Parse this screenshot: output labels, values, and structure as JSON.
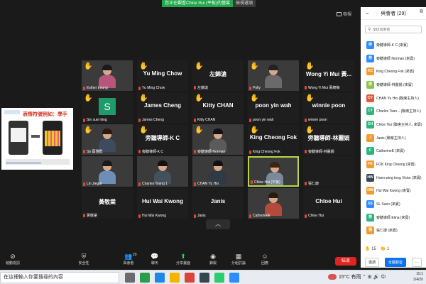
{
  "banner": {
    "sharing": "您正在觀看Chloe Hui (平板)的螢幕",
    "options": "檢視選項"
  },
  "view_label": "檢視",
  "shared_screen": {
    "title": "表情符號例如：學手"
  },
  "tiles": [
    {
      "name": "",
      "label": "Esther Leung",
      "video": true,
      "hand": true,
      "person": {
        "body": "#b5567a",
        "hair": "#1a1a1a"
      }
    },
    {
      "name": "Yu Ming Chow",
      "label": "Yu Ming Chow",
      "video": false,
      "hand": true
    },
    {
      "name": "左錦滄",
      "label": "左錦滄",
      "video": false,
      "hand": true
    },
    {
      "name": "",
      "label": "Polly",
      "video": true,
      "hand": true,
      "person": {
        "body": "#6a6a6a",
        "hair": "#222"
      }
    },
    {
      "name": "Wong Yi Mui 黃...",
      "label": "Wong Yi Mui 黃綺梅",
      "video": false,
      "hand": true
    },
    {
      "name": "",
      "label": "Sin suet king",
      "video": false,
      "hand": true,
      "avatar": "S"
    },
    {
      "name": "James Cheng",
      "label": "James Cheng",
      "video": false,
      "hand": true
    },
    {
      "name": "Kitty CHAN",
      "label": "Kitty CHAN",
      "video": false,
      "hand": true
    },
    {
      "name": "poon yin wah",
      "label": "poon yin wah",
      "video": false,
      "hand": true
    },
    {
      "name": "winnie poon",
      "label": "winnie poon",
      "video": false,
      "hand": true
    },
    {
      "name": "",
      "label": "Sb 蔡雅群",
      "video": true,
      "hand": true,
      "person": {
        "body": "#3d4b5c",
        "hair": "#2a1b12"
      }
    },
    {
      "name": "旁聽導師-K C",
      "label": "旁聽導師-K C",
      "video": false,
      "hand": true
    },
    {
      "name": "",
      "label": "旁聽導師 Norman",
      "video": true,
      "hand": true,
      "person": {
        "body": "#5b5b5b",
        "hair": "#111"
      }
    },
    {
      "name": "King Cheong Fok",
      "label": "King Cheong Fok",
      "video": false,
      "hand": true
    },
    {
      "name": "旁聽導師-林麗娟",
      "label": "旁聽導師-林麗娟",
      "video": false,
      "hand": true
    },
    {
      "name": "",
      "label": "Lin Jiegui",
      "video": true,
      "hand": false,
      "person": {
        "body": "#6c8fb8",
        "hair": "#1a1a1a"
      }
    },
    {
      "name": "",
      "label": "Charles Tsang 1",
      "video": true,
      "hand": false,
      "person": {
        "body": "#44505c",
        "hair": "#111"
      }
    },
    {
      "name": "",
      "label": "CHAN Yu Hin",
      "video": true,
      "hand": false,
      "person": {
        "body": "#2f3a44",
        "hair": "#111"
      }
    },
    {
      "name": "",
      "label": "Chloe Hui (平板)",
      "video": true,
      "hand": false,
      "active": true,
      "person": {
        "body": "#7a8a9a",
        "hair": "#3a2414"
      }
    },
    {
      "name": "",
      "label": "張仁康",
      "video": false,
      "hand": false
    },
    {
      "name": "黃敬棠",
      "label": "黃敬棠",
      "video": false,
      "hand": false
    },
    {
      "name": "Hui Wai Kwong",
      "label": "Hui Wai Kwong",
      "video": false,
      "hand": false
    },
    {
      "name": "Janis",
      "label": "Janis",
      "video": false,
      "hand": false
    },
    {
      "name": "",
      "label": "CatherineE",
      "video": true,
      "hand": false,
      "person": {
        "body": "#b34a3c",
        "hair": "#2b1a10"
      }
    },
    {
      "name": "Chloe Hui",
      "label": "Chloe Hui",
      "video": false,
      "hand": false
    }
  ],
  "panel": {
    "title": "與會者 (29)",
    "search_placeholder": "尋找與會者",
    "participants": [
      {
        "initials": "旁",
        "color": "#2d8cff",
        "name": "旁聽導師-K C (來賓)"
      },
      {
        "initials": "旁",
        "color": "#2d8cff",
        "name": "旁聽導師 Norman (來賓)"
      },
      {
        "initials": "KC",
        "color": "#f29b2c",
        "name": "King Cheong Fok (來賓)"
      },
      {
        "initials": "旁",
        "color": "#8bc34a",
        "name": "旁聽導師-林麗娟 (來賓)"
      },
      {
        "initials": "CY",
        "color": "#e05a3a",
        "name": "CHAN Yu Hin (聯席主持人)"
      },
      {
        "initials": "CT",
        "color": "#2cb67d",
        "name": "Charles Tsan... (聯席主持人)"
      },
      {
        "initials": "CH",
        "color": "#2cb67d",
        "name": "Chloe Hui (聯席主持人, 來賓)"
      },
      {
        "initials": "J",
        "color": "#f29b2c",
        "name": "Janis (聯席主持人)"
      },
      {
        "initials": "C",
        "color": "#2cb67d",
        "name": "CatherineE (來賓)"
      },
      {
        "initials": "FK",
        "color": "#f29b2c",
        "name": "FOK King Cheong (來賓)"
      },
      {
        "initials": "HW",
        "color": "#37474f",
        "name": "Huen wing tong Victor (來賓)"
      },
      {
        "initials": "HW",
        "color": "#f29b2c",
        "name": "Hui Wai Kwong (來賓)"
      },
      {
        "initials": "SS",
        "color": "#2d8cff",
        "name": "SL Suen (來賓)"
      },
      {
        "initials": "旁",
        "color": "#2cb67d",
        "name": "旁聽導師 Elina (來賓)"
      },
      {
        "initials": "張",
        "color": "#f29b2c",
        "name": "張仁康 (來賓)"
      }
    ],
    "reactions": {
      "hand": "15",
      "clap": "1"
    },
    "invite": "邀請",
    "mute_all": "全體靜音",
    "more": "..."
  },
  "toolbar": {
    "audio": "啟動視訊",
    "security": "安全性",
    "participants": "與會者",
    "participants_count": "29",
    "chat": "聊天",
    "share": "分享畫面",
    "record": "錄製",
    "breakout": "分組討論",
    "reactions": "回應",
    "end": "結束"
  },
  "taskbar": {
    "search_text": "在這裡輸入你要搜尋的內容",
    "weather": "15°C 有雨",
    "time": "10:1",
    "date": "2/4/20"
  },
  "colors": {
    "accent": "#0e72ed",
    "end": "#e0241f",
    "share_green": "#23d959",
    "active_border": "#b8d64b"
  }
}
